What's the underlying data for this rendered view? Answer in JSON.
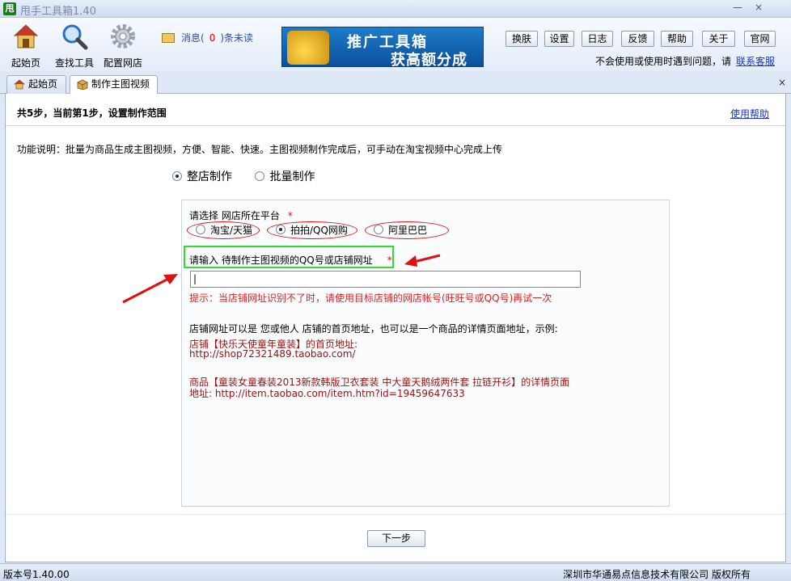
{
  "window": {
    "title": "甩手工具箱",
    "version": "1.40",
    "logo_text": "甩",
    "minimize": "—",
    "close": "×"
  },
  "toolbar": {
    "home": "起始页",
    "find_tools": "查找工具",
    "config_store": "配置网店",
    "msg_prefix": "消息(",
    "msg_count": "0",
    "msg_suffix": ")条未读",
    "banner_line1": "推广工具箱",
    "banner_line2": "获高额分成",
    "buttons": [
      "换肤",
      "设置",
      "日志",
      "反馈",
      "帮助",
      "关于",
      "官网"
    ],
    "help_text": "不会使用或使用时遇到问题，请",
    "help_link": "联系客服"
  },
  "tabs": [
    {
      "label": "起始页"
    },
    {
      "label": "制作主图视频"
    }
  ],
  "tab_close": "×",
  "panel": {
    "step_text": "共5步，当前第1步，设置制作范围",
    "help_link": "使用帮助",
    "description": "功能说明：批量为商品生成主图视频，方便、智能、快速。主图视频制作完成后，可手动在淘宝视频中心完成上传",
    "modes": [
      {
        "label": "整店制作",
        "selected": true
      },
      {
        "label": "批量制作",
        "selected": false
      }
    ],
    "platform_label": "请选择 网店所在平台",
    "platforms": [
      {
        "label": "淘宝/天猫",
        "selected": false
      },
      {
        "label": "拍拍/QQ网购",
        "selected": true
      },
      {
        "label": "阿里巴巴",
        "selected": false
      }
    ],
    "required_mark": "*",
    "url_label": "请输入 待制作主图视频的QQ号或店铺网址",
    "url_value": "|",
    "hint": "提示：当店铺网址识别不了时，请使用目标店铺的网店帐号(旺旺号或QQ号)再试一次",
    "example_intro": "店铺网址可以是 您或他人 店铺的首页地址，也可以是一个商品的详情页面地址，示例:",
    "example1_line1": "店铺【快乐天使童年童装】的首页地址:",
    "example1_line2": "http://shop72321489.taobao.com/",
    "example2_line1": "商品【童装女童春装2013新款韩版卫衣套装 中大童天鹅绒两件套 拉链开衫】的详情页面",
    "example2_line2": "地址: http://item.taobao.com/item.htm?id=19459647633",
    "next_button": "下一步"
  },
  "status": {
    "version": "版本号1.40.00",
    "copyright": "深圳市华通易点信息技术有限公司 版权所有"
  },
  "colors": {
    "accent_red": "#e01010",
    "highlight_green": "#2fdc2f",
    "link_blue": "#1a35c6"
  }
}
